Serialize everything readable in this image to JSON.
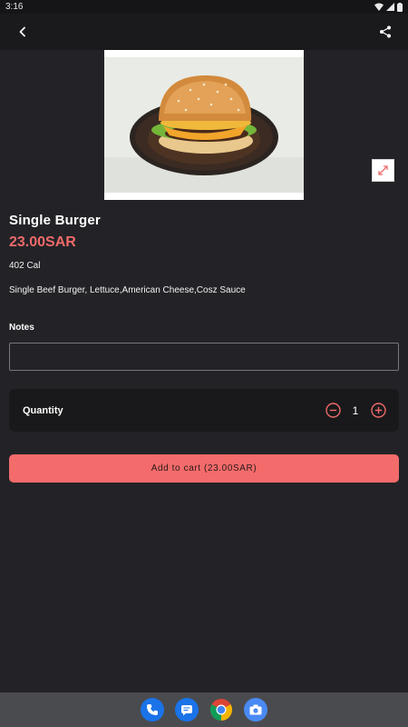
{
  "status": {
    "time": "3:16"
  },
  "icons": {
    "back": "back-arrow-icon",
    "share": "share-icon",
    "expand": "expand-icon",
    "minus": "minus-circle-icon",
    "plus": "plus-circle-icon"
  },
  "product": {
    "name": "Single Burger",
    "price": "23.00SAR",
    "calories": "402 Cal",
    "description": "Single Beef Burger, Lettuce,American Cheese,Cosz Sauce"
  },
  "notes": {
    "label": "Notes",
    "value": "",
    "placeholder": ""
  },
  "quantity": {
    "label": "Quantity",
    "value": "1"
  },
  "cart": {
    "button_label": "Add to cart (23.00SAR)"
  },
  "colors": {
    "accent": "#f46b6b",
    "price": "#ef6a6a",
    "background": "#232327",
    "card": "#19191b"
  },
  "dock": [
    "phone-icon",
    "messages-icon",
    "chrome-icon",
    "camera-icon"
  ]
}
